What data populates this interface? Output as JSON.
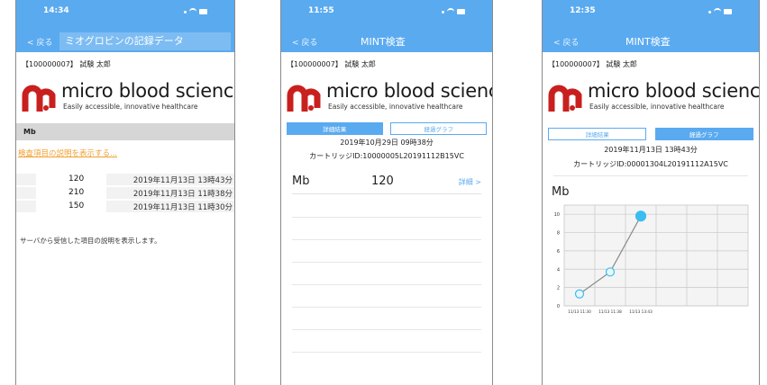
{
  "colors": {
    "header": "#5aaaf0",
    "accent": "#5aaaf0",
    "link": "#f0a030",
    "brand_red": "#c8201e",
    "chart_point": "#3bbdf0"
  },
  "logo": {
    "name": "micro blood science",
    "tagline": "Easily accessible, innovative healthcare"
  },
  "screen1": {
    "clock": "14:34",
    "back": "< 戻る",
    "title": "ミオグロビンの記録データ",
    "patient": "【100000007】 試験 太郎",
    "item": "Mb",
    "desc_link": "検査項目の説明を表示する...",
    "rows": [
      {
        "value": "120",
        "date": "2019年11月13日 13時43分"
      },
      {
        "value": "210",
        "date": "2019年11月13日 11時38分"
      },
      {
        "value": "150",
        "date": "2019年11月13日 11時30分"
      }
    ],
    "server_note": "サーバから受信した項目の説明を表示します。"
  },
  "screen2": {
    "clock": "11:55",
    "back": "< 戻る",
    "title": "MINT検査",
    "patient": "【100000007】 試験 太郎",
    "tabs": [
      "詳細結果",
      "経過グラフ"
    ],
    "active_tab": 0,
    "datetime": "2019年10月29日 09時38分",
    "cartridge": "カートリッジID:10000005L20191112B15VC",
    "result": {
      "item": "Mb",
      "value": "120",
      "detail": "詳細 >"
    }
  },
  "screen3": {
    "clock": "12:35",
    "back": "< 戻る",
    "title": "MINT検査",
    "patient": "【100000007】 試験 太郎",
    "tabs": [
      "詳細結果",
      "経過グラフ"
    ],
    "active_tab": 1,
    "datetime": "2019年11月13日 13時43分",
    "cartridge": "カートリッジID:00001304L20191112A15VC",
    "item": "Mb"
  },
  "chart_data": {
    "type": "line",
    "categories": [
      "11/13 11:30",
      "11/13 11:38",
      "11/13 13:43"
    ],
    "values": [
      1.3,
      3.7,
      9.8
    ],
    "yticks": [
      0,
      2,
      4,
      6,
      8,
      10
    ],
    "ylim": [
      0,
      11
    ],
    "grid": true,
    "title": "",
    "xlabel": "",
    "ylabel": ""
  }
}
